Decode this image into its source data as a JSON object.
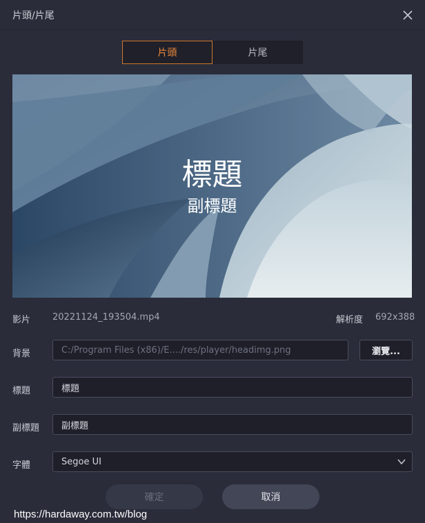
{
  "window": {
    "title": "片頭/片尾"
  },
  "tabs": [
    {
      "label": "片頭",
      "active": true
    },
    {
      "label": "片尾",
      "active": false
    }
  ],
  "preview": {
    "title": "標題",
    "subtitle": "副標題"
  },
  "video": {
    "label": "影片",
    "filename": "20221124_193504.mp4",
    "resolution_label": "解析度",
    "resolution": "692x388"
  },
  "background": {
    "label": "背景",
    "path": "C:/Program Files (x86)/E..../res/player/headimg.png",
    "browse_label": "瀏覽..."
  },
  "title_field": {
    "label": "標題",
    "value": "標題"
  },
  "subtitle_field": {
    "label": "副標題",
    "value": "副標題"
  },
  "font_field": {
    "label": "字體",
    "value": "Segoe UI"
  },
  "buttons": {
    "ok": "確定",
    "cancel": "取消"
  },
  "watermark": "https://hardaway.com.tw/blog",
  "colors": {
    "accent": "#e8873a",
    "background": "#2a2c3a",
    "field": "#1e1f29"
  },
  "icons": {
    "close": "close-icon",
    "dropdown": "chevron-down-icon"
  }
}
